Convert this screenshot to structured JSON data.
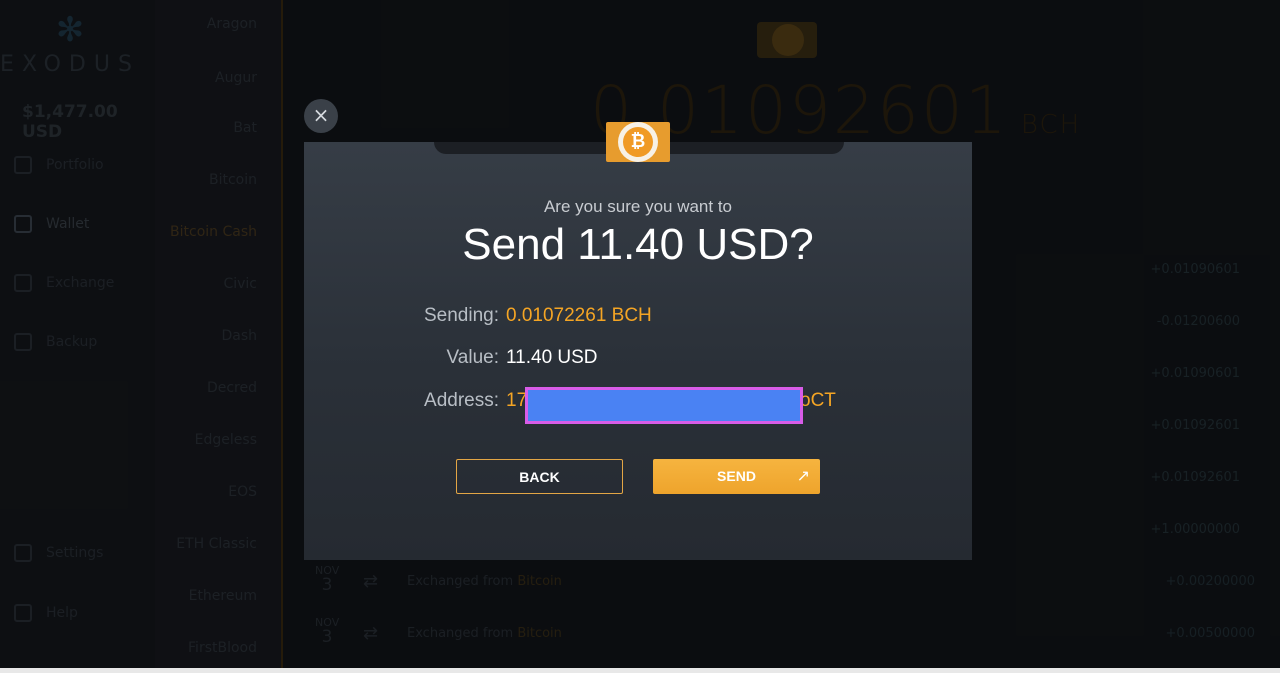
{
  "app": {
    "logo_text": "EXODUS",
    "total_balance": "$1,477.00 USD"
  },
  "nav": {
    "items": [
      {
        "label": "Portfolio",
        "icon": "chart-icon"
      },
      {
        "label": "Wallet",
        "icon": "wallet-icon"
      },
      {
        "label": "Exchange",
        "icon": "exchange-icon"
      },
      {
        "label": "Backup",
        "icon": "backup-icon"
      },
      {
        "label": "Settings",
        "icon": "settings-icon"
      },
      {
        "label": "Help",
        "icon": "help-icon"
      }
    ]
  },
  "assets": [
    "Aragon",
    "Augur",
    "Bat",
    "Bitcoin",
    "Bitcoin Cash",
    "Civic",
    "Dash",
    "Decred",
    "Edgeless",
    "EOS",
    "ETH Classic",
    "Ethereum",
    "FirstBlood"
  ],
  "background": {
    "amount": "0.01092601",
    "unit": "BCH",
    "tx_values": [
      "+0.01090601",
      "-0.01200600",
      "+0.01090601",
      "+0.01092601",
      "+0.01092601",
      "+1.00000000",
      "+0.00200000",
      "+0.00500000"
    ],
    "tx_rows": [
      {
        "month": "NOV",
        "day": "3",
        "desc": "Exchanged from",
        "coin": "Bitcoin"
      },
      {
        "month": "NOV",
        "day": "3",
        "desc": "Exchanged from",
        "coin": "Bitcoin"
      }
    ]
  },
  "dialog": {
    "close_label": "×",
    "prompt": "Are you sure you want to",
    "title": "Send 11.40 USD?",
    "sending_label": "Sending:",
    "sending_value": "0.01072261 BCH",
    "value_label": "Value:",
    "value_value": "11.40 USD",
    "address_label": "Address:",
    "address_value": "17T",
    "address_suffix": "oCT",
    "back_label": "BACK",
    "send_label": "SEND",
    "coin_symbol": "₿"
  },
  "colors": {
    "accent": "#f5a524",
    "redaction": "#4a82f3",
    "redaction_border": "#d85ce8"
  }
}
